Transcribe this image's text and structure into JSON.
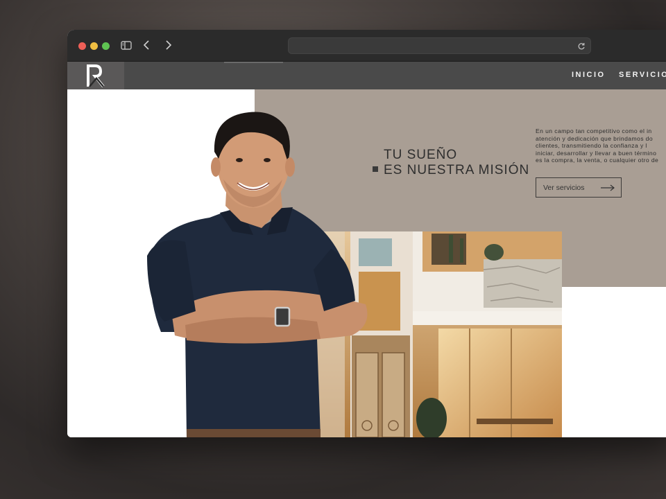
{
  "nav": {
    "items": [
      {
        "label": "INICIO"
      },
      {
        "label": "SERVICIOS"
      }
    ]
  },
  "hero": {
    "headline_line1": "TU SUEÑO",
    "headline_line2": "ES NUESTRA MISIÓN",
    "paragraph_lines": [
      "En un campo tan competitivo como el in",
      "atención y dedicación que brindamos do",
      "clientes, transmitiendo la confianza y l",
      "iniciar, desarrollar y llevar a buen término",
      "es la compra, la venta, o cualquier otro de"
    ],
    "cta_label": "Ver servicios"
  },
  "colors": {
    "accent_taupe": "#a99e94",
    "nav_bg": "#4a4a4a",
    "shirt_navy": "#1f2a3d"
  }
}
